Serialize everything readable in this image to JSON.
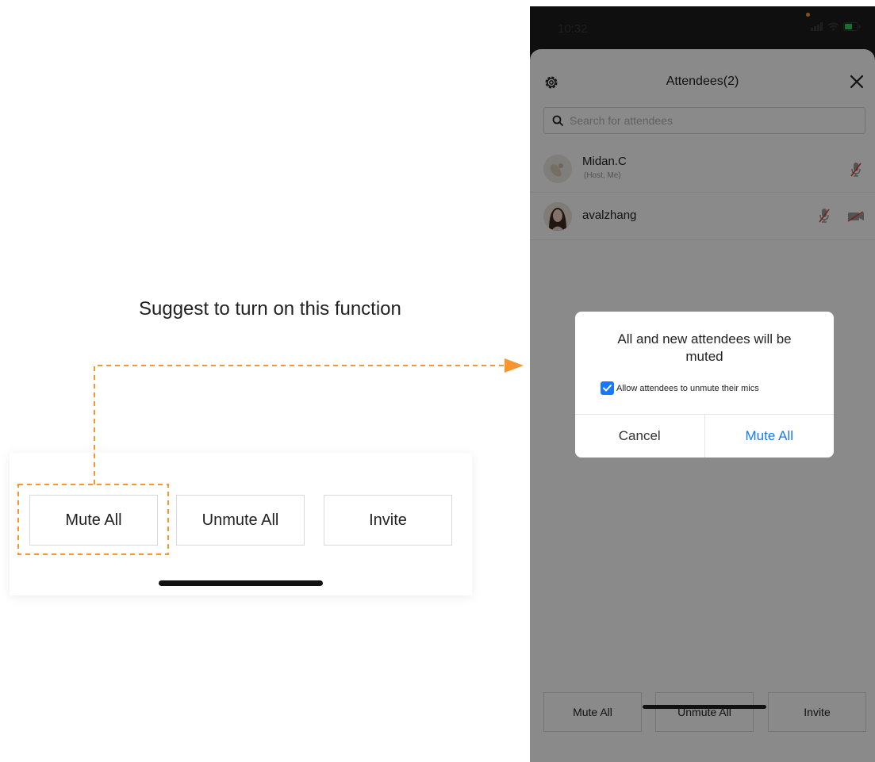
{
  "annotation": {
    "text": "Suggest to turn on this function",
    "accent_color": "#f7952f"
  },
  "zoomed_toolbar": {
    "buttons": [
      "Mute All",
      "Unmute All",
      "Invite"
    ]
  },
  "phone": {
    "status": {
      "time": "10:32"
    },
    "sheet": {
      "title": "Attendees(2)",
      "settings_icon": "gear-icon",
      "close_icon": "close-icon",
      "search_placeholder": "Search for attendees",
      "attendees": [
        {
          "name": "Midan.C",
          "role": "(Host, Me)",
          "icons": [
            "mic-muted-icon"
          ]
        },
        {
          "name": "avalzhang",
          "role": "",
          "icons": [
            "mic-muted-icon",
            "camera-off-icon"
          ]
        }
      ],
      "bottom_buttons": [
        "Mute All",
        "Unmute All",
        "Invite"
      ]
    },
    "dialog": {
      "message": "All and new attendees will be muted",
      "checkbox_label": "Allow attendees to unmute their mics",
      "checkbox_checked": true,
      "cancel_label": "Cancel",
      "confirm_label": "Mute All",
      "accent_color": "#1677ff"
    }
  }
}
